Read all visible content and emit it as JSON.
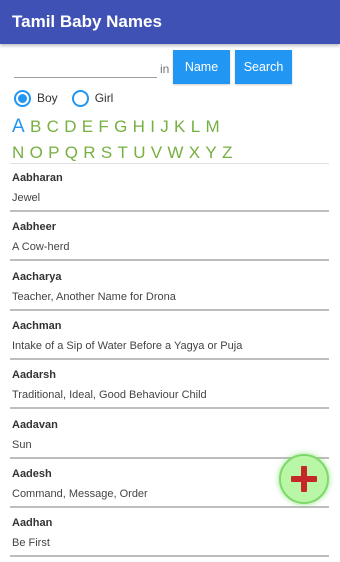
{
  "app": {
    "title": "Tamil Baby Names"
  },
  "search": {
    "value": "",
    "placeholder": "",
    "in_label": "in",
    "name_button": "Name",
    "search_button": "Search"
  },
  "gender": {
    "options": [
      "Boy",
      "Girl"
    ],
    "selected": "Boy"
  },
  "alphabet": {
    "row1": [
      "A",
      "B",
      "C",
      "D",
      "E",
      "F",
      "G",
      "H",
      "I",
      "J",
      "K",
      "L",
      "M"
    ],
    "row2": [
      "N",
      "O",
      "P",
      "Q",
      "R",
      "S",
      "T",
      "U",
      "V",
      "W",
      "X",
      "Y",
      "Z"
    ],
    "active": "A"
  },
  "names": [
    {
      "name": "Aabharan",
      "meaning": "Jewel"
    },
    {
      "name": "Aabheer",
      "meaning": "A Cow-herd"
    },
    {
      "name": "Aacharya",
      "meaning": "Teacher, Another Name for Drona"
    },
    {
      "name": "Aachman",
      "meaning": "Intake of a Sip of Water Before a Yagya or Puja"
    },
    {
      "name": "Aadarsh",
      "meaning": "Traditional, Ideal, Good Behaviour Child"
    },
    {
      "name": "Aadavan",
      "meaning": "Sun"
    },
    {
      "name": "Aadesh",
      "meaning": "Command, Message, Order"
    },
    {
      "name": "Aadhan",
      "meaning": "Be First"
    }
  ],
  "fab": {
    "icon": "plus-icon"
  },
  "colors": {
    "appbar": "#3f51b5",
    "button": "#2196f3",
    "letter": "#76b041",
    "fab": "#b9f6a6",
    "plus": "#c62828"
  }
}
